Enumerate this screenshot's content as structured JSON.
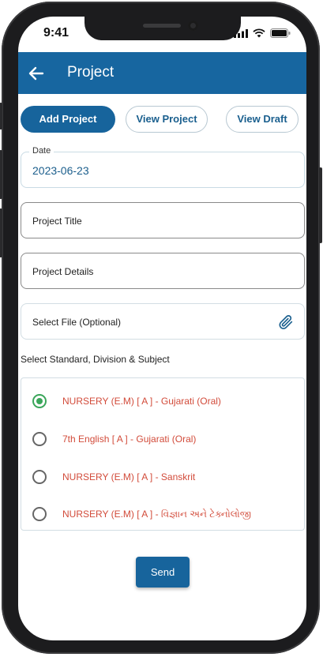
{
  "status_bar": {
    "time": "9:41"
  },
  "header": {
    "title": "Project",
    "back_icon": "arrow-left-icon"
  },
  "tabs": [
    {
      "label": "Add Project",
      "active": true
    },
    {
      "label": "View Project",
      "active": false
    },
    {
      "label": "View Draft",
      "active": false
    }
  ],
  "form": {
    "date": {
      "label": "Date",
      "value": "2023-06-23"
    },
    "project_title": {
      "placeholder": "Project Title"
    },
    "project_details": {
      "placeholder": "Project Details"
    },
    "select_file": {
      "label": "Select File (Optional)",
      "icon": "paperclip-icon"
    }
  },
  "subject_section": {
    "label": "Select Standard, Division & Subject",
    "options": [
      {
        "label": "NURSERY (E.M) [ A ]  - Gujarati (Oral)",
        "selected": true
      },
      {
        "label": "7th English [ A ]  - Gujarati (Oral)",
        "selected": false
      },
      {
        "label": "NURSERY (E.M) [ A ]  - Sanskrit",
        "selected": false
      },
      {
        "label": "NURSERY (E.M) [ A ]  - વિજ્ઞાન અને ટેક્નોલોજી",
        "selected": false
      }
    ]
  },
  "send_button": {
    "label": "Send"
  },
  "colors": {
    "primary": "#1766a0",
    "accent_text": "#1a5f8e",
    "option_text": "#d24b3a",
    "radio_selected": "#3aa65a"
  }
}
